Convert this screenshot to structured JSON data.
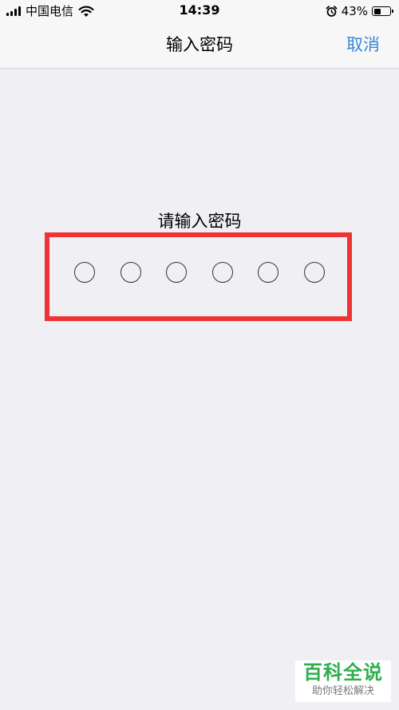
{
  "status_bar": {
    "carrier": "中国电信",
    "time": "14:39",
    "battery": "43%",
    "battery_level": 0.43,
    "icons": [
      "signal-icon",
      "wifi-icon",
      "alarm-icon",
      "battery-icon"
    ]
  },
  "nav": {
    "title": "输入密码",
    "cancel_label": "取消"
  },
  "passcode": {
    "prompt": "请输入密码",
    "digit_count": 6,
    "entered": 0
  },
  "watermark": {
    "top": "百科全说",
    "bottom": "助你轻松解决"
  },
  "colors": {
    "accent": "#3a87d6",
    "highlight": "#ee3434",
    "background": "#f0eff4",
    "watermark_green": "#2fae4e"
  }
}
